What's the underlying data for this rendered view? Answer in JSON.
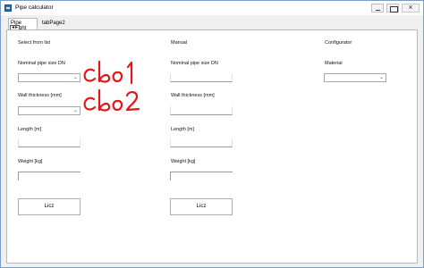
{
  "window": {
    "title": "Pipe calculator"
  },
  "tabs": [
    {
      "label": "Pipe weight"
    },
    {
      "label": "tabPage2"
    }
  ],
  "select_from_list": {
    "heading": "Select from list",
    "nominal_label": "Nominal pipe size DN",
    "wall_label": "Wall thickness [mm]",
    "length_label": "Length [m]",
    "weight_label": "Weight [kg]",
    "button_label": "Licz"
  },
  "manual": {
    "heading": "Manual",
    "nominal_label": "Nominal pipe size DN",
    "wall_label": "Wall thickness [mm]",
    "length_label": "Length [m]",
    "weight_label": "Weight [kg]",
    "button_label": "Licz"
  },
  "configurator": {
    "heading": "Configurator",
    "material_label": "Material"
  },
  "annotations": {
    "cb1": "cbo1",
    "cb2": "cbo2",
    "color": "#e0161b"
  },
  "icons": {
    "app": "app-window-icon",
    "dropdown": "chevron-down-icon"
  }
}
